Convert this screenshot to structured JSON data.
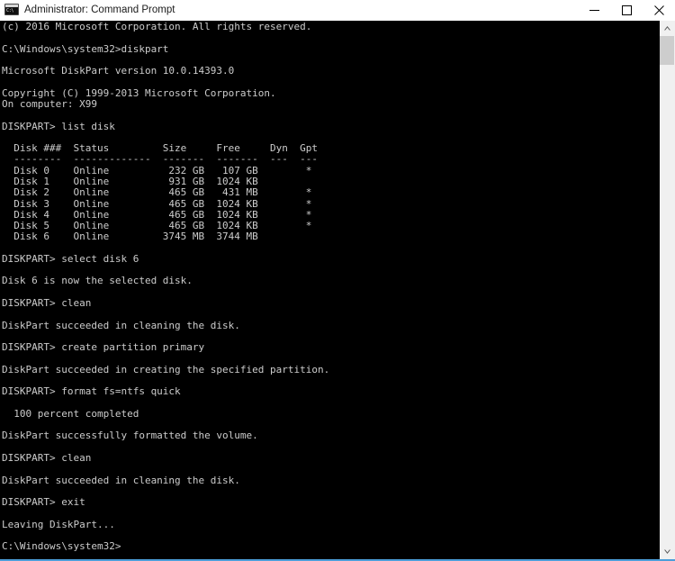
{
  "window": {
    "title": "Administrator: Command Prompt",
    "icon_name": "console-icon",
    "icon_glyph": "C:\\",
    "accent_color": "#4c9ed9",
    "background_color": "#000000",
    "titlebar_color": "#ffffff",
    "text_color": "#cccccc"
  },
  "controls": {
    "minimize_label": "Minimize",
    "maximize_label": "Maximize",
    "close_label": "Close"
  },
  "scrollbar": {
    "up_label": "Scroll up",
    "down_label": "Scroll down",
    "thumb_label": "Scroll thumb"
  },
  "console": {
    "prompt": "DISKPART>",
    "shell_prompt": "C:\\Windows\\system32>",
    "lines": [
      "(c) 2016 Microsoft Corporation. All rights reserved.",
      "",
      "C:\\Windows\\system32>diskpart",
      "",
      "Microsoft DiskPart version 10.0.14393.0",
      "",
      "Copyright (C) 1999-2013 Microsoft Corporation.",
      "On computer: X99",
      "",
      "DISKPART> list disk",
      "",
      "  Disk ###  Status         Size     Free     Dyn  Gpt",
      "  --------  -------------  -------  -------  ---  ---",
      "  Disk 0    Online          232 GB   107 GB        *",
      "  Disk 1    Online          931 GB  1024 KB",
      "  Disk 2    Online          465 GB   431 MB        *",
      "  Disk 3    Online          465 GB  1024 KB        *",
      "  Disk 4    Online          465 GB  1024 KB        *",
      "  Disk 5    Online          465 GB  1024 KB        *",
      "  Disk 6    Online         3745 MB  3744 MB",
      "",
      "DISKPART> select disk 6",
      "",
      "Disk 6 is now the selected disk.",
      "",
      "DISKPART> clean",
      "",
      "DiskPart succeeded in cleaning the disk.",
      "",
      "DISKPART> create partition primary",
      "",
      "DiskPart succeeded in creating the specified partition.",
      "",
      "DISKPART> format fs=ntfs quick",
      "",
      "  100 percent completed",
      "",
      "DiskPart successfully formatted the volume.",
      "",
      "DISKPART> clean",
      "",
      "DiskPart succeeded in cleaning the disk.",
      "",
      "DISKPART> exit",
      "",
      "Leaving DiskPart...",
      "",
      "C:\\Windows\\system32>"
    ],
    "disk_table": {
      "headers": [
        "Disk ###",
        "Status",
        "Size",
        "Free",
        "Dyn",
        "Gpt"
      ],
      "rows": [
        {
          "disk": "Disk 0",
          "status": "Online",
          "size": "232 GB",
          "free": "107 GB",
          "dyn": "",
          "gpt": "*"
        },
        {
          "disk": "Disk 1",
          "status": "Online",
          "size": "931 GB",
          "free": "1024 KB",
          "dyn": "",
          "gpt": ""
        },
        {
          "disk": "Disk 2",
          "status": "Online",
          "size": "465 GB",
          "free": "431 MB",
          "dyn": "",
          "gpt": "*"
        },
        {
          "disk": "Disk 3",
          "status": "Online",
          "size": "465 GB",
          "free": "1024 KB",
          "dyn": "",
          "gpt": "*"
        },
        {
          "disk": "Disk 4",
          "status": "Online",
          "size": "465 GB",
          "free": "1024 KB",
          "dyn": "",
          "gpt": "*"
        },
        {
          "disk": "Disk 5",
          "status": "Online",
          "size": "465 GB",
          "free": "1024 KB",
          "dyn": "",
          "gpt": "*"
        },
        {
          "disk": "Disk 6",
          "status": "Online",
          "size": "3745 MB",
          "free": "3744 MB",
          "dyn": "",
          "gpt": ""
        }
      ]
    },
    "commands_issued": [
      "diskpart",
      "list disk",
      "select disk 6",
      "clean",
      "create partition primary",
      "format fs=ntfs quick",
      "clean",
      "exit"
    ],
    "version": "10.0.14393.0",
    "computer_name": "X99",
    "copyright": "Copyright (C) 1999-2013 Microsoft Corporation.",
    "progress_percent": "100"
  }
}
